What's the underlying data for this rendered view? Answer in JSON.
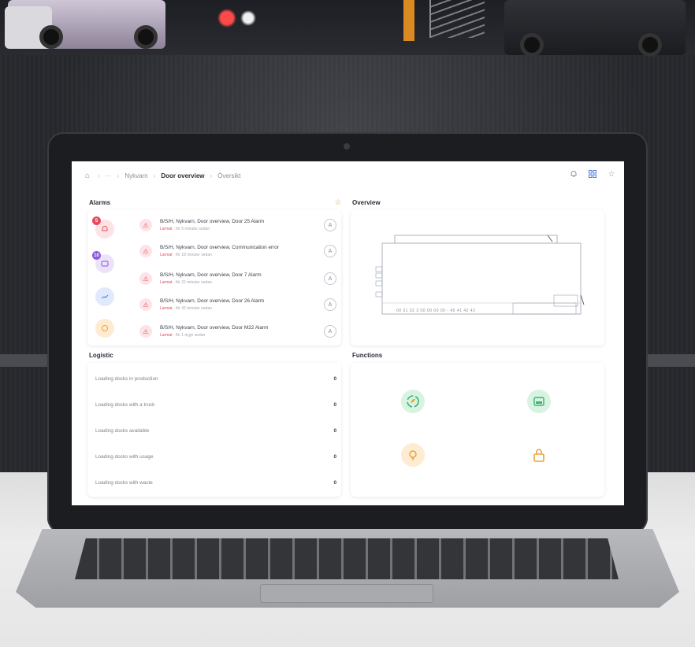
{
  "breadcrumb": {
    "home_icon": "home-icon",
    "ellipsis": "···",
    "items": [
      "Nykvarn",
      "Door overview",
      "Översikt"
    ]
  },
  "header_icons": [
    "bell-icon",
    "grid-icon",
    "star-icon"
  ],
  "alarms": {
    "title": "Alarms",
    "star_icon": "star-icon",
    "side_counters": [
      {
        "icon": "bell-icon",
        "badge": "5",
        "color": "#e74a5f"
      },
      {
        "icon": "chat-icon",
        "badge": "10",
        "color": "#8a5ad9"
      },
      {
        "icon": "trend-icon",
        "badge": "",
        "color": "#4f7bd9"
      },
      {
        "icon": "ok-icon",
        "badge": "",
        "color": "#e8a33a"
      }
    ],
    "items": [
      {
        "title": "B/S/H, Nykvarn, Door overview, Door 25 Alarm",
        "level": "Larmat",
        "time": "för 6 minuter sedan",
        "action": "A"
      },
      {
        "title": "B/S/H, Nykvarn, Door overview, Communication error",
        "level": "Larmat",
        "time": "för 18 minuter sedan",
        "action": "A"
      },
      {
        "title": "B/S/H, Nykvarn, Door overview, Door 7 Alarm",
        "level": "Larmat",
        "time": "för 22 minuter sedan",
        "action": "A"
      },
      {
        "title": "B/S/H, Nykvarn, Door overview, Door 26 Alarm",
        "level": "Larmat",
        "time": "för 42 minuter sedan",
        "action": "A"
      },
      {
        "title": "B/S/H, Nykvarn, Door overview, Door M22 Alarm",
        "level": "Larmat",
        "time": "för 1 dygn sedan",
        "action": "A"
      }
    ]
  },
  "overview": {
    "title": "Overview",
    "dock_labels": "00 01 02 3 00 00 00 00 - 40 41 42 43"
  },
  "logistic": {
    "title": "Logistic",
    "rows": [
      {
        "label": "Loading docks in production",
        "value": "0"
      },
      {
        "label": "Loading docks with a truck",
        "value": "0"
      },
      {
        "label": "Loading docks available",
        "value": "0"
      },
      {
        "label": "Loading docks with usage",
        "value": "0"
      },
      {
        "label": "Loading docks with waste",
        "value": "0"
      }
    ]
  },
  "functions": {
    "title": "Functions",
    "items": [
      {
        "icon": "leaf-refresh-icon",
        "color": "#3cb371",
        "bg": "#d9f3e3"
      },
      {
        "icon": "card-reader-icon",
        "color": "#3cb371",
        "bg": "#d9f3e3"
      },
      {
        "icon": "lightbulb-icon",
        "color": "#e8a33a",
        "bg": "#fdecd2"
      },
      {
        "icon": "lock-icon",
        "color": "#e8a33a",
        "bg": "#ffffff"
      }
    ]
  }
}
